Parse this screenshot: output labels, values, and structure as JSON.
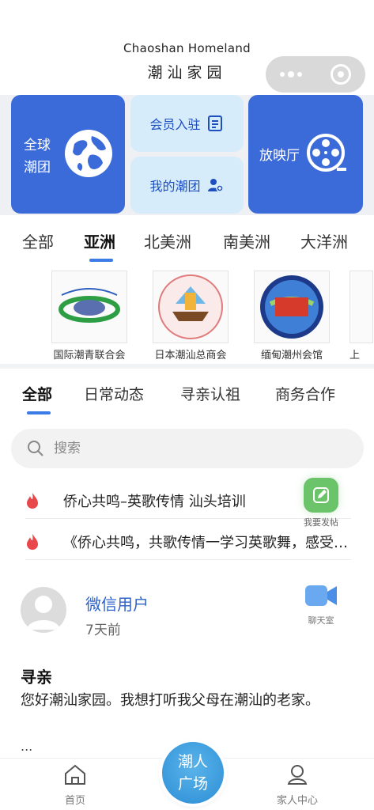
{
  "header": {
    "title_en": "Chaoshan Homeland",
    "title_cn": "潮汕家园"
  },
  "tiles": {
    "global_label": "全球潮团",
    "join_label": "会员入驻",
    "my_groups_label": "我的潮团",
    "cinema_label": "放映厅",
    "icons": [
      "globe-icon",
      "form-icon",
      "group-icon",
      "film-reel-icon"
    ]
  },
  "region_tabs": [
    "全部",
    "亚洲",
    "北美洲",
    "南美洲",
    "大洋洲"
  ],
  "region_selected": "亚洲",
  "orgs": [
    {
      "name": "国际潮青联合会"
    },
    {
      "name": "日本潮汕总商会"
    },
    {
      "name": "缅甸潮州会馆"
    },
    {
      "name": "上"
    }
  ],
  "category_tabs": [
    "全部",
    "日常动态",
    "寻亲认祖",
    "商务合作"
  ],
  "category_selected": "全部",
  "search": {
    "placeholder": "搜索"
  },
  "hot_items": [
    {
      "text": "侨心共鸣–英歌传情 汕头培训"
    },
    {
      "text": "《侨心共鸣，共歌传情一学习英歌舞，感受潮汕文化魅力》"
    }
  ],
  "post_fab_label": "我要发帖",
  "post": {
    "user_name": "微信用户",
    "time": "7天前",
    "chat_label": "聊天室",
    "title": "寻亲",
    "body": "您好潮汕家园。我想打听我父母在潮汕的老家。",
    "more": "..."
  },
  "bottom_nav": {
    "home_label": "首页",
    "center_label_1": "潮人",
    "center_label_2": "广场",
    "family_label": "家人中心"
  },
  "colors": {
    "primary_blue": "#3b6ad9",
    "light_blue": "#d6ecfb",
    "accent_underline": "#3b7be6",
    "hot_red": "#e8474c",
    "fab_green": "#6cc46a"
  }
}
